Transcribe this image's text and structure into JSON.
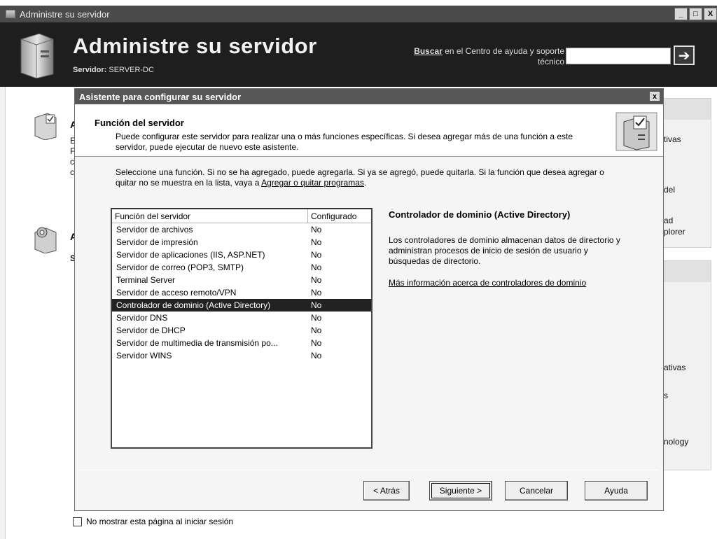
{
  "window": {
    "title": "Administre su servidor",
    "min_glyph": "_",
    "max_glyph": "□",
    "close_glyph": "X"
  },
  "banner": {
    "title": "Administre su servidor",
    "server_label": "Servidor:",
    "server_name": "SERVER-DC",
    "search_link": "Buscar",
    "search_text": " en el Centro de ayuda y soporte técnico",
    "search_value": "",
    "go_glyph": "➔"
  },
  "background": {
    "left_letters": [
      "A",
      "A"
    ],
    "left_fragments": [
      "E",
      "F",
      "c",
      "c",
      "S"
    ],
    "right_fragments": [
      "tivas",
      "del",
      "ad",
      "plorer",
      "ativas",
      "s",
      "nology"
    ]
  },
  "dialog": {
    "title": "Asistente para configurar su servidor",
    "close_glyph": "x",
    "header_title": "Función del servidor",
    "header_desc": "Puede configurar este servidor para realizar una o más funciones específicas. Si desea agregar más de una función a este servidor, puede ejecutar de nuevo este asistente.",
    "instructions_pre": "Seleccione una función. Si no se ha agregado, puede agregarla. Si ya se agregó, puede quitarla. Si la función que desea agregar o quitar no se muestra en la lista, vaya a ",
    "instructions_link": "Agregar o quitar programas",
    "instructions_post": ".",
    "list": {
      "col1": "Función del servidor",
      "col2": "Configurado",
      "rows": [
        {
          "role": "Servidor de archivos",
          "configured": "No"
        },
        {
          "role": "Servidor de impresión",
          "configured": "No"
        },
        {
          "role": "Servidor de aplicaciones (IIS, ASP.NET)",
          "configured": "No"
        },
        {
          "role": "Servidor de correo (POP3, SMTP)",
          "configured": "No"
        },
        {
          "role": "Terminal Server",
          "configured": "No"
        },
        {
          "role": "Servidor de acceso remoto/VPN",
          "configured": "No"
        },
        {
          "role": "Controlador de dominio (Active Directory)",
          "configured": "No"
        },
        {
          "role": "Servidor DNS",
          "configured": "No"
        },
        {
          "role": "Servidor de DHCP",
          "configured": "No"
        },
        {
          "role": "Servidor de multimedia de transmisión po...",
          "configured": "No"
        },
        {
          "role": "Servidor WINS",
          "configured": "No"
        }
      ],
      "selected_index": 6
    },
    "details": {
      "title": "Controlador de dominio (Active Directory)",
      "text": "Los controladores de dominio almacenan datos de directorio y administran procesos de inicio de sesión de usuario y búsquedas de directorio.",
      "link": "Más información acerca de controladores de dominio"
    },
    "buttons": {
      "back": "< Atrás",
      "next": "Siguiente >",
      "cancel": "Cancelar",
      "help": "Ayuda"
    }
  },
  "footer": {
    "checkbox_label": "No mostrar esta página al iniciar sesión",
    "checked": false
  }
}
